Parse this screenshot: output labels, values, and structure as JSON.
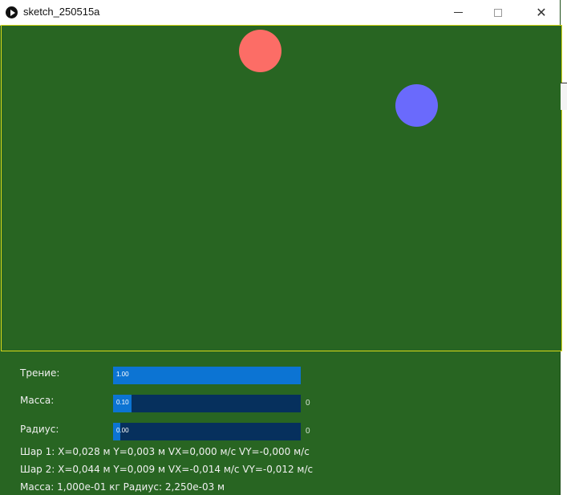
{
  "window": {
    "title": "sketch_250515a",
    "controls": {
      "minimize": "—",
      "maximize": "□",
      "close": "✕"
    }
  },
  "canvas": {
    "background": "#286522",
    "border_color": "#d8d81a",
    "balls": [
      {
        "name": "ball-1",
        "color": "#fc6d66"
      },
      {
        "name": "ball-2",
        "color": "#6a6afc"
      }
    ]
  },
  "controls": {
    "friction": {
      "label": "Трение:",
      "value_text": "1.00",
      "fill_fraction": 1.0,
      "suffix": ""
    },
    "mass": {
      "label": "Масса:",
      "value_text": "0.10",
      "fill_fraction": 0.1,
      "suffix": "0"
    },
    "radius": {
      "label": "Радиус:",
      "value_text": "0.00",
      "fill_fraction": 0.04,
      "suffix": "0"
    }
  },
  "info": {
    "ball1": "Шар 1: X=0,028 м Y=0,003 м VX=0,000 м/с VY=-0,000 м/с",
    "ball2": "Шар 2: X=0,044 м Y=0,009 м VX=-0,014 м/с VY=-0,012 м/с",
    "summary": "Масса: 1,000e-01 кг  Радиус: 2,250e-03 м"
  },
  "colors": {
    "slider_track": "#06305d",
    "slider_fill": "#0c74d3",
    "panel_bg": "#286522"
  }
}
